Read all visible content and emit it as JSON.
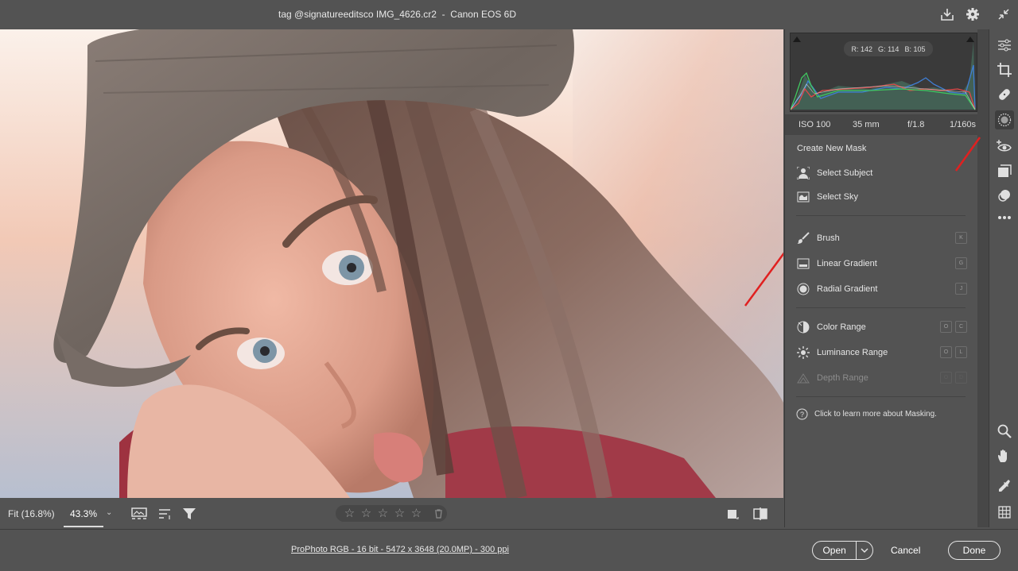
{
  "window": {
    "title": "tag @signatureeditsco IMG_4626.cr2  -  Canon EOS 6D"
  },
  "titlebar_icons": [
    "save-icon",
    "gear-icon",
    "minimize-icon"
  ],
  "histogram": {
    "r_label": "R:",
    "r_value": "142",
    "g_label": "G:",
    "g_value": "114",
    "b_label": "B:",
    "b_value": "105"
  },
  "exif": {
    "iso": "ISO 100",
    "focal": "35 mm",
    "aperture": "f/1.8",
    "shutter": "1/160s"
  },
  "masking": {
    "heading": "Create New Mask",
    "select_subject": "Select Subject",
    "select_sky": "Select Sky",
    "brush": "Brush",
    "brush_key": "K",
    "linear_gradient": "Linear Gradient",
    "linear_key": "G",
    "radial_gradient": "Radial Gradient",
    "radial_key": "J",
    "color_range": "Color Range",
    "color_keys": [
      "O",
      "C"
    ],
    "luminance_range": "Luminance Range",
    "luminance_keys": [
      "O",
      "L"
    ],
    "depth_range": "Depth Range",
    "depth_keys": [
      "O",
      "D"
    ],
    "learn_more": "Click to learn more about Masking."
  },
  "image_toolbar": {
    "zoom_fit": "Fit (16.8%)",
    "zoom_value": "43.3%",
    "rating_stars": 0
  },
  "footer": {
    "info": "ProPhoto RGB - 16 bit - 5472 x 3648 (20.0MP) - 300 ppi",
    "open_label": "Open",
    "cancel_label": "Cancel",
    "done_label": "Done"
  },
  "colors": {
    "panel_bg": "#535353",
    "annotation_arrow": "#e02020"
  },
  "toolstrip_icons": [
    "edit-sliders-icon",
    "crop-icon",
    "healing-icon",
    "masking-icon",
    "red-eye-icon",
    "presets-icon",
    "snapshots-icon",
    "more-icon",
    "zoom-icon",
    "hand-icon",
    "color-sampler-icon",
    "grid-icon"
  ]
}
